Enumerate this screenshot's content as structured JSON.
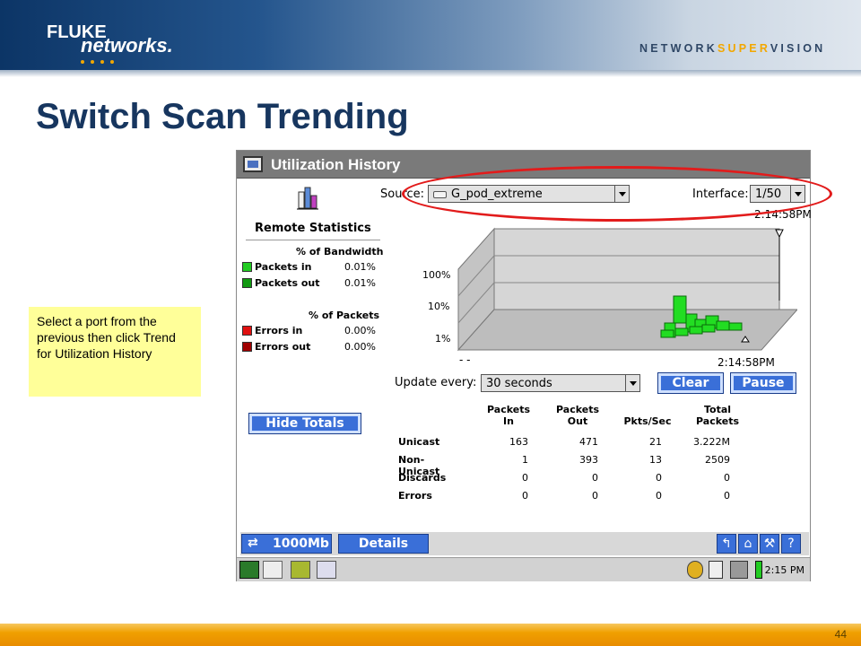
{
  "slide": {
    "brand_top": "FLUKE",
    "brand_bottom": "networks.",
    "tagline_a": "NETWORK",
    "tagline_b": "SUPER",
    "tagline_c": "VISION",
    "title": "Switch Scan Trending",
    "note": "Select a port from the previous then click Trend for Utilization History",
    "page_number": "44"
  },
  "app": {
    "window_title": "Utilization History",
    "remote_stats": {
      "title": "Remote Statistics",
      "bandwidth_header": "% of Bandwidth",
      "packets_header": "% of Packets",
      "rows": [
        {
          "label": "Packets in",
          "value": "0.01%",
          "color": "#22cc22"
        },
        {
          "label": "Packets out",
          "value": "0.01%",
          "color": "#119911"
        },
        {
          "label": "Errors in",
          "value": "0.00%",
          "color": "#e01010"
        },
        {
          "label": "Errors out",
          "value": "0.00%",
          "color": "#a00000"
        }
      ]
    },
    "source_label": "Source:",
    "source_value": "G_pod_extreme",
    "interface_label": "Interface:",
    "interface_value": "1/50",
    "time_top": "2:14:58PM",
    "time_bottom": "2:14:58PM",
    "axis_dash": "- -",
    "chart_data": {
      "type": "bar",
      "y_ticks": [
        "100%",
        "10%",
        "1%"
      ],
      "log_scale": true
    },
    "update_label": "Update every:",
    "update_value": "30 seconds",
    "clear_label": "Clear",
    "pause_label": "Pause",
    "hide_totals_label": "Hide Totals",
    "table": {
      "headers": [
        [
          "Packets",
          "In"
        ],
        [
          "Packets",
          "Out"
        ],
        [
          "",
          "Pkts/Sec"
        ],
        [
          "Total",
          "Packets"
        ]
      ],
      "rows": [
        {
          "label": "Unicast",
          "values": [
            "163",
            "471",
            "21",
            "3.222M"
          ]
        },
        {
          "label": "Non-Unicast",
          "values": [
            "1",
            "393",
            "13",
            "2509"
          ]
        },
        {
          "label": "Discards",
          "values": [
            "0",
            "0",
            "0",
            "0"
          ]
        },
        {
          "label": "Errors",
          "values": [
            "0",
            "0",
            "0",
            "0"
          ]
        }
      ]
    },
    "speed_label": "1000Mb",
    "details_label": "Details",
    "status_icons": [
      "help-arrow-icon",
      "home-tools-icon",
      "wrench-icon",
      "question-icon"
    ],
    "taskbar_time": "2:15 PM"
  }
}
